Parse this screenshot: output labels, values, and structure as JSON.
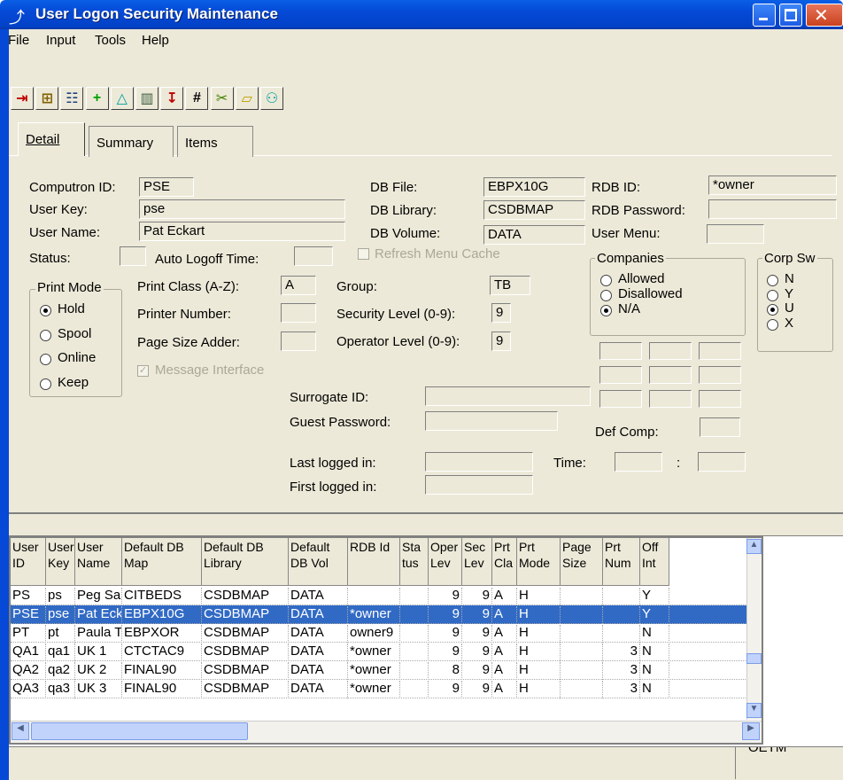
{
  "window": {
    "title": "User Logon Security Maintenance"
  },
  "menu": [
    "File",
    "Input",
    "Tools",
    "Help"
  ],
  "toolbar": [
    {
      "icon": "exit-icon",
      "glyph": "⇥",
      "color": "#c00000"
    },
    {
      "icon": "tree-icon",
      "glyph": "⊞",
      "color": "#806000"
    },
    {
      "icon": "users-icon",
      "glyph": "☷",
      "color": "#204080"
    },
    {
      "icon": "add-icon",
      "glyph": "+",
      "color": "#00a000"
    },
    {
      "icon": "triangle-icon",
      "glyph": "△",
      "color": "#00a0a0"
    },
    {
      "icon": "trash-icon",
      "glyph": "▥",
      "color": "#406040"
    },
    {
      "icon": "import-icon",
      "glyph": "↧",
      "color": "#c00000"
    },
    {
      "icon": "hash-icon",
      "glyph": "#",
      "color": "#000000"
    },
    {
      "icon": "tools-icon",
      "glyph": "✂",
      "color": "#408000"
    },
    {
      "icon": "folder-icon",
      "glyph": "▱",
      "color": "#c0a000"
    },
    {
      "icon": "shapes-icon",
      "glyph": "⚇",
      "color": "#00a0a0"
    }
  ],
  "tabs": [
    "Detail",
    "Summary",
    "Items"
  ],
  "detail": {
    "computron_id_label": "Computron  ID:",
    "computron_id": "PSE",
    "user_key_label": "User Key:",
    "user_key": "pse",
    "user_name_label": "User Name:",
    "user_name": "Pat Eckart",
    "status_label": "Status:",
    "status": "",
    "auto_logoff_label": "Auto Logoff Time:",
    "auto_logoff": "",
    "refresh_menu_label": "Refresh Menu Cache",
    "db_file_label": "DB File:",
    "db_file": "EBPX10G",
    "db_library_label": "DB Library:",
    "db_library": "CSDBMAP",
    "db_volume_label": "DB Volume:",
    "db_volume": "DATA",
    "rdb_id_label": "RDB ID:",
    "rdb_id": "*owner",
    "rdb_password_label": "RDB Password:",
    "rdb_password": "",
    "user_menu_label": "User Menu:",
    "user_menu": "",
    "print_mode_title": "Print Mode",
    "print_modes": [
      "Hold",
      "Spool",
      "Online",
      "Keep"
    ],
    "print_mode_selected": "Hold",
    "print_class_label": "Print Class (A-Z):",
    "print_class": "A",
    "printer_number_label": "Printer Number:",
    "printer_number": "",
    "page_size_label": "Page Size Adder:",
    "page_size": "",
    "message_interface_label": "Message Interface",
    "group_label": "Group:",
    "group": "TB",
    "security_level_label": "Security Level (0-9):",
    "security_level": "9",
    "operator_level_label": "Operator Level (0-9):",
    "operator_level": "9",
    "companies_title": "Companies",
    "companies": [
      "Allowed",
      "Disallowed",
      "N/A"
    ],
    "companies_selected": "N/A",
    "corp_sw_title": "Corp Sw",
    "corp_sw": [
      "N",
      "Y",
      "U",
      "X"
    ],
    "corp_sw_selected": "U",
    "surrogate_label": "Surrogate ID:",
    "guest_password_label": "Guest Password:",
    "def_comp_label": "Def Comp:",
    "last_logged_label": "Last logged in:",
    "first_logged_label": "First logged in:",
    "time_label": "Time:",
    "time_sep": ":"
  },
  "grid": {
    "columns": [
      "User ID",
      "User Key",
      "User Name",
      "Default DB Map",
      "Default DB Library",
      "Default DB Vol",
      "RDB Id",
      "Sta tus",
      "Oper Lev",
      "Sec Lev",
      "Prt Cla",
      "Prt Mode",
      "Page Size",
      "Prt Num",
      "Off Int"
    ],
    "rows": [
      [
        "PS",
        "ps",
        "Peg Samu",
        "CITBEDS",
        "CSDBMAP",
        "DATA",
        "",
        "",
        "9",
        "9",
        "A",
        "H",
        "",
        "",
        "Y"
      ],
      [
        "PSE",
        "pse",
        "Pat Eckart",
        "EBPX10G",
        "CSDBMAP",
        "DATA",
        "*owner",
        "",
        "9",
        "9",
        "A",
        "H",
        "",
        "",
        "Y"
      ],
      [
        "PT",
        "pt",
        "Paula Timi",
        "EBPXOR",
        "CSDBMAP",
        "DATA",
        "owner9",
        "",
        "9",
        "9",
        "A",
        "H",
        "",
        "",
        "N"
      ],
      [
        "QA1",
        "qa1",
        "UK 1",
        "CTCTAC9",
        "CSDBMAP",
        "DATA",
        "*owner",
        "",
        "9",
        "9",
        "A",
        "H",
        "",
        "3",
        "N"
      ],
      [
        "QA2",
        "qa2",
        "UK 2",
        "FINAL90",
        "CSDBMAP",
        "DATA",
        "*owner",
        "",
        "8",
        "9",
        "A",
        "H",
        "",
        "3",
        "N"
      ],
      [
        "QA3",
        "qa3",
        "UK 3",
        "FINAL90",
        "CSDBMAP",
        "DATA",
        "*owner",
        "",
        "9",
        "9",
        "A",
        "H",
        "",
        "3",
        "N"
      ]
    ],
    "selected_row": 1
  },
  "status_bar": {
    "text": "OETM"
  },
  "colors": {
    "selection": "#316ac5",
    "titlebar": "#0549d6",
    "face": "#ece9d8"
  }
}
